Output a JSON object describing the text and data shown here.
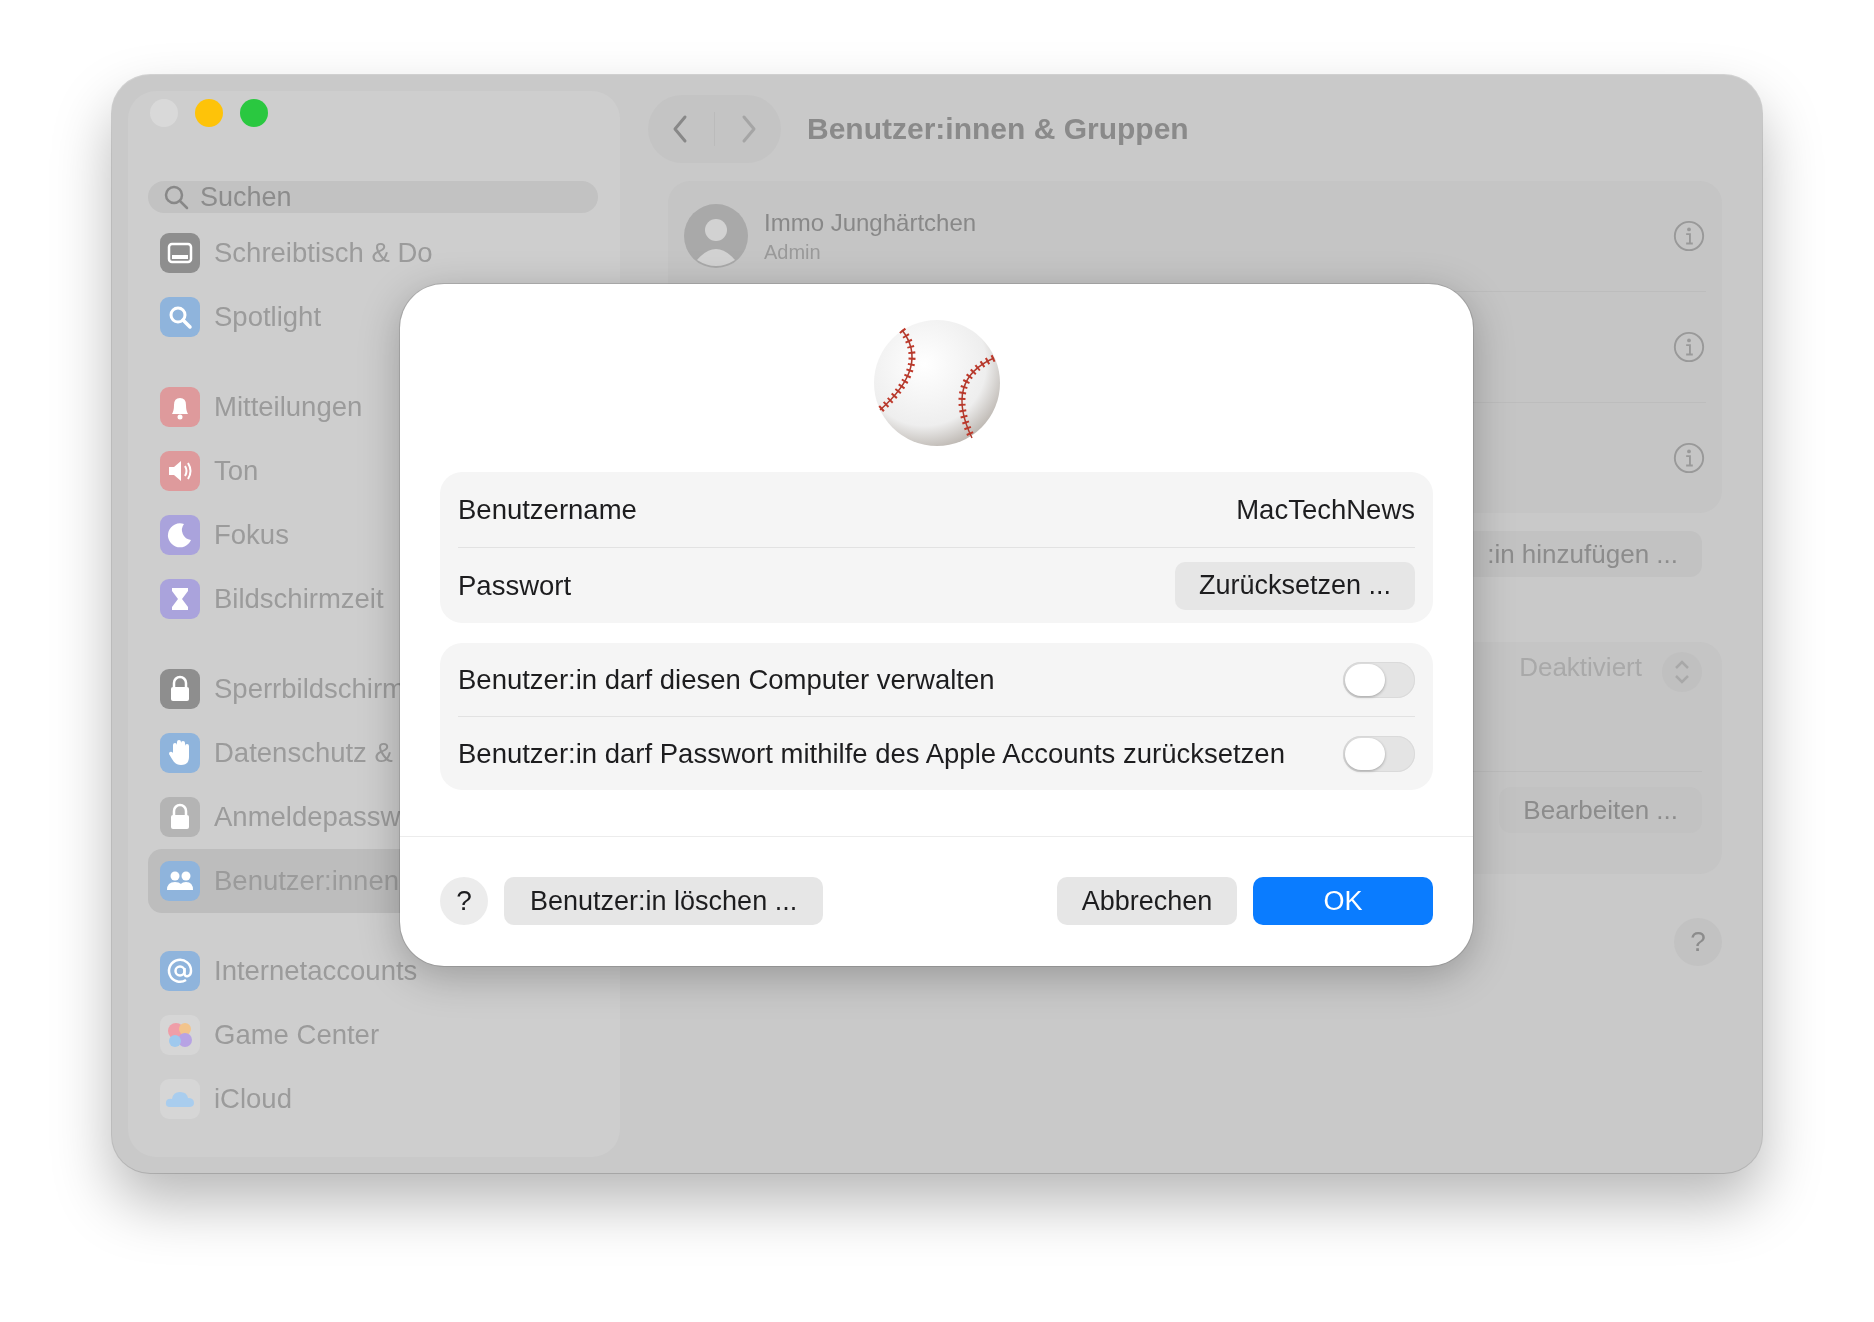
{
  "window": {
    "title": "Benutzer:innen & Gruppen"
  },
  "sidebar": {
    "search": {
      "placeholder": "Suchen"
    },
    "sections": [
      [
        {
          "label": "Schreibtisch & Do",
          "kind": "dock",
          "color": "#8e8e8e",
          "selected": false
        },
        {
          "label": "Spotlight",
          "kind": "search",
          "color": "#8fb4dc",
          "selected": false
        }
      ],
      [
        {
          "label": "Mitteilungen",
          "kind": "bell",
          "color": "#de9a9c",
          "selected": false
        },
        {
          "label": "Ton",
          "kind": "speaker",
          "color": "#de9a9c",
          "selected": false
        },
        {
          "label": "Fokus",
          "kind": "moon",
          "color": "#aaa3dc",
          "selected": false
        },
        {
          "label": "Bildschirmzeit",
          "kind": "hourglass",
          "color": "#aaa3dc",
          "selected": false
        }
      ],
      [
        {
          "label": "Sperrbildschirm",
          "kind": "lock",
          "color": "#8e8e8e",
          "selected": false
        },
        {
          "label": "Datenschutz &",
          "kind": "hand",
          "color": "#8fb4dc",
          "selected": false
        },
        {
          "label": "Anmeldepassw",
          "kind": "lock",
          "color": "#b4b4b4",
          "selected": false
        },
        {
          "label": "Benutzer:innen",
          "kind": "people",
          "color": "#8fb4dc",
          "selected": true
        }
      ],
      [
        {
          "label": "Internetaccounts",
          "kind": "at",
          "color": "#8fb4dc",
          "selected": false
        },
        {
          "label": "Game Center",
          "kind": "bubbles",
          "color": "#d6d6d6",
          "selected": false
        },
        {
          "label": "iCloud",
          "kind": "cloud",
          "color": "#d6d6d6",
          "selected": false
        }
      ]
    ]
  },
  "content": {
    "users": [
      {
        "name": "Immo Junghärtchen",
        "role": "Admin"
      }
    ],
    "add_button": ":in hinzufügen ...",
    "auto_login": {
      "value": "Deaktiviert"
    },
    "edit_button": "Bearbeiten ...",
    "help": "?"
  },
  "dialog": {
    "username_label": "Benutzername",
    "username": "MacTechNews",
    "password_label": "Passwort",
    "reset_button": "Zurücksetzen ...",
    "toggles": [
      {
        "label": "Benutzer:in darf diesen Computer verwalten",
        "on": false
      },
      {
        "label": "Benutzer:in darf Passwort mithilfe des Apple Accounts zurücksetzen",
        "on": false
      }
    ],
    "help": "?",
    "delete_button": "Benutzer:in löschen ...",
    "cancel_button": "Abbrechen",
    "ok_button": "OK"
  }
}
